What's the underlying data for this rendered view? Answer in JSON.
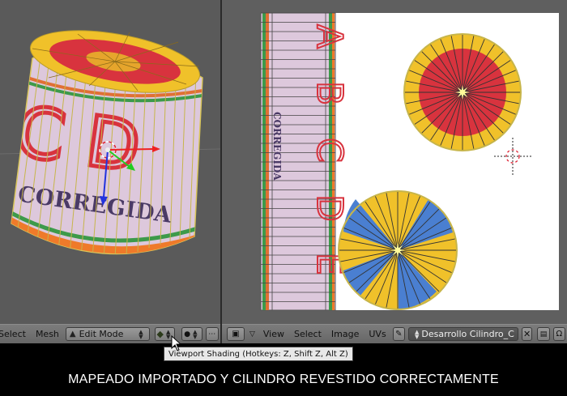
{
  "viewport3d": {
    "label_letters": "C D",
    "label_word": "CORREGIDA"
  },
  "uv_editor": {
    "strip_letters": [
      "A",
      "B",
      "C",
      "D",
      "E"
    ],
    "strip_word": "CORREGIDA"
  },
  "left_header": {
    "select_label": "Select",
    "mesh_label": "Mesh",
    "mode_label": "Edit Mode"
  },
  "right_header": {
    "view_label": "View",
    "select_label": "Select",
    "image_label": "Image",
    "uvs_label": "UVs",
    "image_name": "Desarrollo Cilindro_C"
  },
  "tooltip": {
    "text": "Viewport Shading (Hotkeys: Z, Shift Z, Alt Z)"
  },
  "caption": {
    "text": "MAPEADO IMPORTADO Y CILINDRO REVESTIDO CORRECTAMENTE"
  },
  "colors": {
    "label_pink": "#ddc8dc",
    "red": "#d8333e",
    "yellow": "#f0c12a",
    "blue": "#4a7fd1",
    "green": "#3d9a4a",
    "orange": "#ef7a2a"
  }
}
